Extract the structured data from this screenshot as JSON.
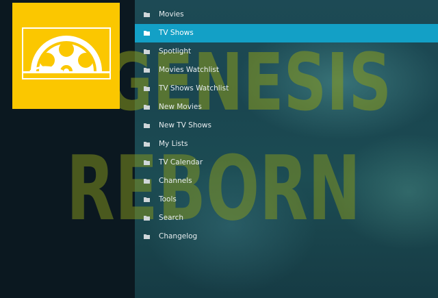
{
  "addon": {
    "watermark_lines": [
      "GENESIS",
      "REBORN"
    ]
  },
  "menu": {
    "selected_index": 1,
    "items": [
      {
        "label": "Movies",
        "icon": "folder-icon"
      },
      {
        "label": "TV Shows",
        "icon": "folder-icon"
      },
      {
        "label": "Spotlight",
        "icon": "folder-icon"
      },
      {
        "label": "Movies Watchlist",
        "icon": "folder-icon"
      },
      {
        "label": "TV Shows Watchlist",
        "icon": "folder-icon"
      },
      {
        "label": "New Movies",
        "icon": "folder-icon"
      },
      {
        "label": "New TV Shows",
        "icon": "folder-icon"
      },
      {
        "label": "My Lists",
        "icon": "folder-icon"
      },
      {
        "label": "TV Calendar",
        "icon": "folder-icon"
      },
      {
        "label": "Channels",
        "icon": "folder-icon"
      },
      {
        "label": "Tools",
        "icon": "folder-icon"
      },
      {
        "label": "Search",
        "icon": "folder-icon"
      },
      {
        "label": "Changelog",
        "icon": "folder-icon"
      }
    ]
  },
  "colors": {
    "highlight": "#13a0c6",
    "poster_bg": "#fbc700",
    "watermark": "#8a9a1c"
  }
}
